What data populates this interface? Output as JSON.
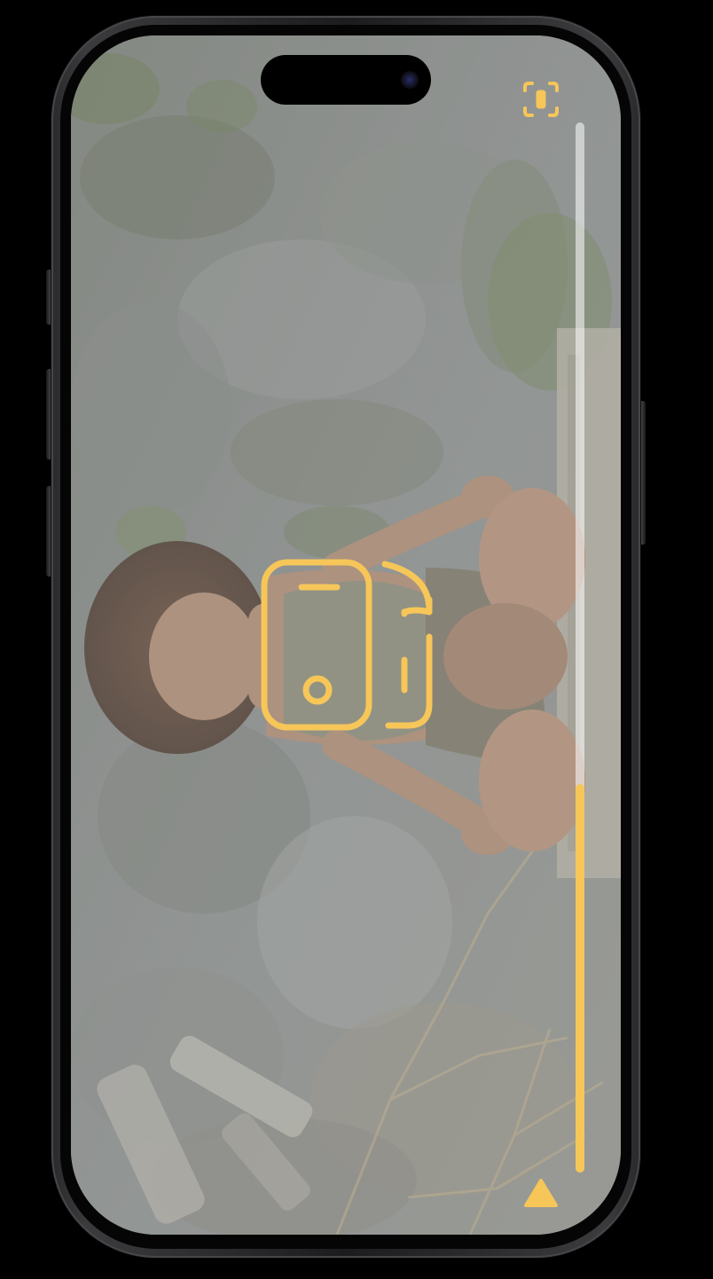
{
  "accent_color": "#f6c659",
  "icons": {
    "focus": "viewfinder-portrait-icon",
    "rotate": "rotate-device-icon",
    "thumb": "triangle-up-icon"
  },
  "scrubber": {
    "progress": 0.37
  }
}
